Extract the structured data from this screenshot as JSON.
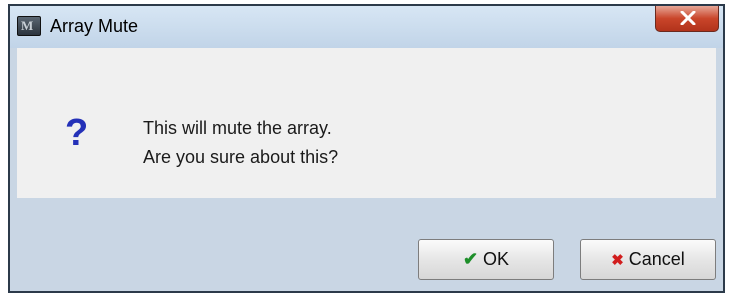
{
  "window": {
    "title": "Array Mute",
    "app_icon_text": "M"
  },
  "message": {
    "icon": "?",
    "line1": "This will mute the array.",
    "line2": "Are you sure about this?"
  },
  "buttons": {
    "ok_icon": "✔",
    "ok_label": "OK",
    "cancel_icon": "✖",
    "cancel_label": "Cancel"
  },
  "colors": {
    "question_icon": "#2431b8",
    "ok_check": "#1e8f2a",
    "cancel_cross": "#d11d1d",
    "close_button": "#c9452a"
  }
}
